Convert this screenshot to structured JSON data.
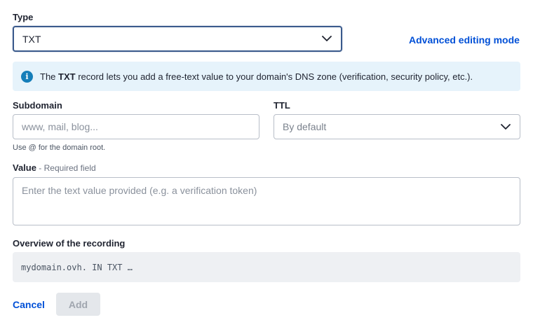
{
  "type": {
    "label": "Type",
    "value": "TXT"
  },
  "advanced_link": "Advanced editing mode",
  "info": {
    "icon": "info-icon",
    "prefix": "The ",
    "record": "TXT",
    "text": " record lets you add a free-text value to your domain's DNS zone (verification, security policy, etc.)."
  },
  "subdomain": {
    "label": "Subdomain",
    "placeholder": "www, mail, blog...",
    "value": "",
    "hint": "Use @ for the domain root."
  },
  "ttl": {
    "label": "TTL",
    "value": "By default"
  },
  "value_field": {
    "label": "Value",
    "sublabel": " - Required field",
    "placeholder": "Enter the text value provided (e.g. a verification token)",
    "value": ""
  },
  "overview": {
    "label": "Overview of the recording",
    "text": "mydomain.ovh. IN TXT …"
  },
  "actions": {
    "cancel": "Cancel",
    "add": "Add"
  },
  "colors": {
    "accent": "#0050d7",
    "info_bg": "#e6f3fb",
    "info_icon": "#157eb9"
  }
}
